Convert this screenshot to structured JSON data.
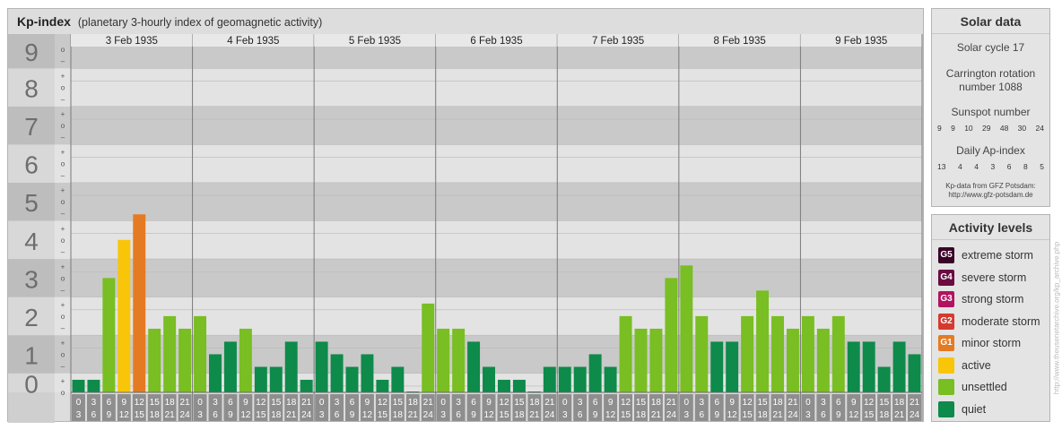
{
  "header": {
    "title": "Kp-index",
    "subtitle": "(planetary 3-hourly index of geomagnetic activity)"
  },
  "chart_data": {
    "type": "bar",
    "ylim": [
      0,
      9
    ],
    "y_ticks": [
      "0",
      "1",
      "2",
      "3",
      "4",
      "5",
      "6",
      "7",
      "8",
      "9"
    ],
    "minor_tick_labels": [
      "+",
      "o",
      "–"
    ],
    "days": [
      {
        "label": "3 Feb 1935",
        "values": [
          0.33,
          0.33,
          3.0,
          4.0,
          4.67,
          1.67,
          2.0,
          1.67
        ]
      },
      {
        "label": "4 Feb 1935",
        "values": [
          2.0,
          1.0,
          1.33,
          1.67,
          0.67,
          0.67,
          1.33,
          0.33
        ]
      },
      {
        "label": "5 Feb 1935",
        "values": [
          1.33,
          1.0,
          0.67,
          1.0,
          0.33,
          0.67,
          0.0,
          2.33
        ]
      },
      {
        "label": "6 Feb 1935",
        "values": [
          1.67,
          1.67,
          1.33,
          0.67,
          0.33,
          0.33,
          0.0,
          0.67
        ]
      },
      {
        "label": "7 Feb 1935",
        "values": [
          0.67,
          0.67,
          1.0,
          0.67,
          2.0,
          1.67,
          1.67,
          3.0
        ]
      },
      {
        "label": "8 Feb 1935",
        "values": [
          3.33,
          2.0,
          1.33,
          1.33,
          2.0,
          2.67,
          2.0,
          1.67
        ]
      },
      {
        "label": "9 Feb 1935",
        "values": [
          2.0,
          1.67,
          2.0,
          1.33,
          1.33,
          0.67,
          1.33,
          1.0
        ]
      }
    ],
    "interval_labels": [
      [
        "0",
        "3"
      ],
      [
        "3",
        "6"
      ],
      [
        "6",
        "9"
      ],
      [
        "9",
        "12"
      ],
      [
        "12",
        "15"
      ],
      [
        "15",
        "18"
      ],
      [
        "18",
        "21"
      ],
      [
        "21",
        "24"
      ]
    ],
    "colors": {
      "quiet": "#0e8a4a",
      "unsettled": "#79be22",
      "active": "#f9c508",
      "G1": "#e47b22",
      "G2": "#d53a2f",
      "G3": "#b1135f",
      "G4": "#6b0b40",
      "G5": "#3a0426"
    }
  },
  "solar": {
    "title": "Solar data",
    "cycle": "Solar cycle 17",
    "carrington_line1": "Carrington rotation",
    "carrington_line2": "number 1088",
    "sunspot_title": "Sunspot number",
    "sunspot_values": [
      "9",
      "9",
      "10",
      "29",
      "48",
      "30",
      "24"
    ],
    "ap_title": "Daily Ap-index",
    "ap_values": [
      "13",
      "4",
      "4",
      "3",
      "6",
      "8",
      "5"
    ],
    "credit_line1": "Kp-data from GFZ Potsdam:",
    "credit_line2": "http://www.gfz-potsdam.de"
  },
  "activity": {
    "title": "Activity levels",
    "items": [
      {
        "code": "G5",
        "label": "extreme storm",
        "color": "#3a0426"
      },
      {
        "code": "G4",
        "label": "severe storm",
        "color": "#6b0b40"
      },
      {
        "code": "G3",
        "label": "strong storm",
        "color": "#b1135f"
      },
      {
        "code": "G2",
        "label": "moderate storm",
        "color": "#d53a2f"
      },
      {
        "code": "G1",
        "label": "minor storm",
        "color": "#e47b22"
      },
      {
        "code": "",
        "label": "active",
        "color": "#f9c508"
      },
      {
        "code": "",
        "label": "unsettled",
        "color": "#79be22"
      },
      {
        "code": "",
        "label": "quiet",
        "color": "#0e8a4a"
      }
    ]
  },
  "side_note": "http://www.theusenetarchive.org/kp_archive.php"
}
